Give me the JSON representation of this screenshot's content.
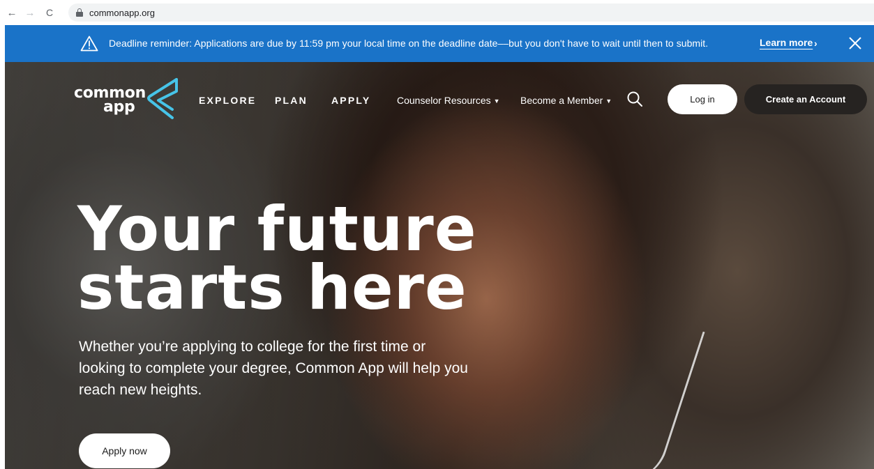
{
  "browser": {
    "back_glyph": "←",
    "forward_glyph": "→",
    "reload_glyph": "C",
    "url": "commonapp.org"
  },
  "banner": {
    "text": "Deadline reminder: Applications are due by 11:59 pm your local time on the deadline date––but you don't have to wait until then to submit.",
    "learn_more": "Learn more",
    "chevron": "›",
    "icons": {
      "warning": "warning-icon",
      "close": "close-icon"
    }
  },
  "header": {
    "logo": {
      "line1": "common",
      "line2": "app"
    },
    "nav": {
      "explore": "EXPLORE",
      "plan": "PLAN",
      "apply": "APPLY",
      "counselor_resources": "Counselor Resources",
      "become_member": "Become a Member",
      "caret": "▼"
    },
    "login": "Log in",
    "create_account": "Create an Account"
  },
  "hero": {
    "headline_line1": "Your future",
    "headline_line2": "starts here",
    "subtext": "Whether you’re applying to college for the first time or looking to complete your degree, Common App will help you reach new heights.",
    "cta": "Apply now"
  },
  "colors": {
    "banner_bg": "#1a73c8",
    "logo_accent": "#47c4e8",
    "create_btn_bg": "#262321"
  }
}
